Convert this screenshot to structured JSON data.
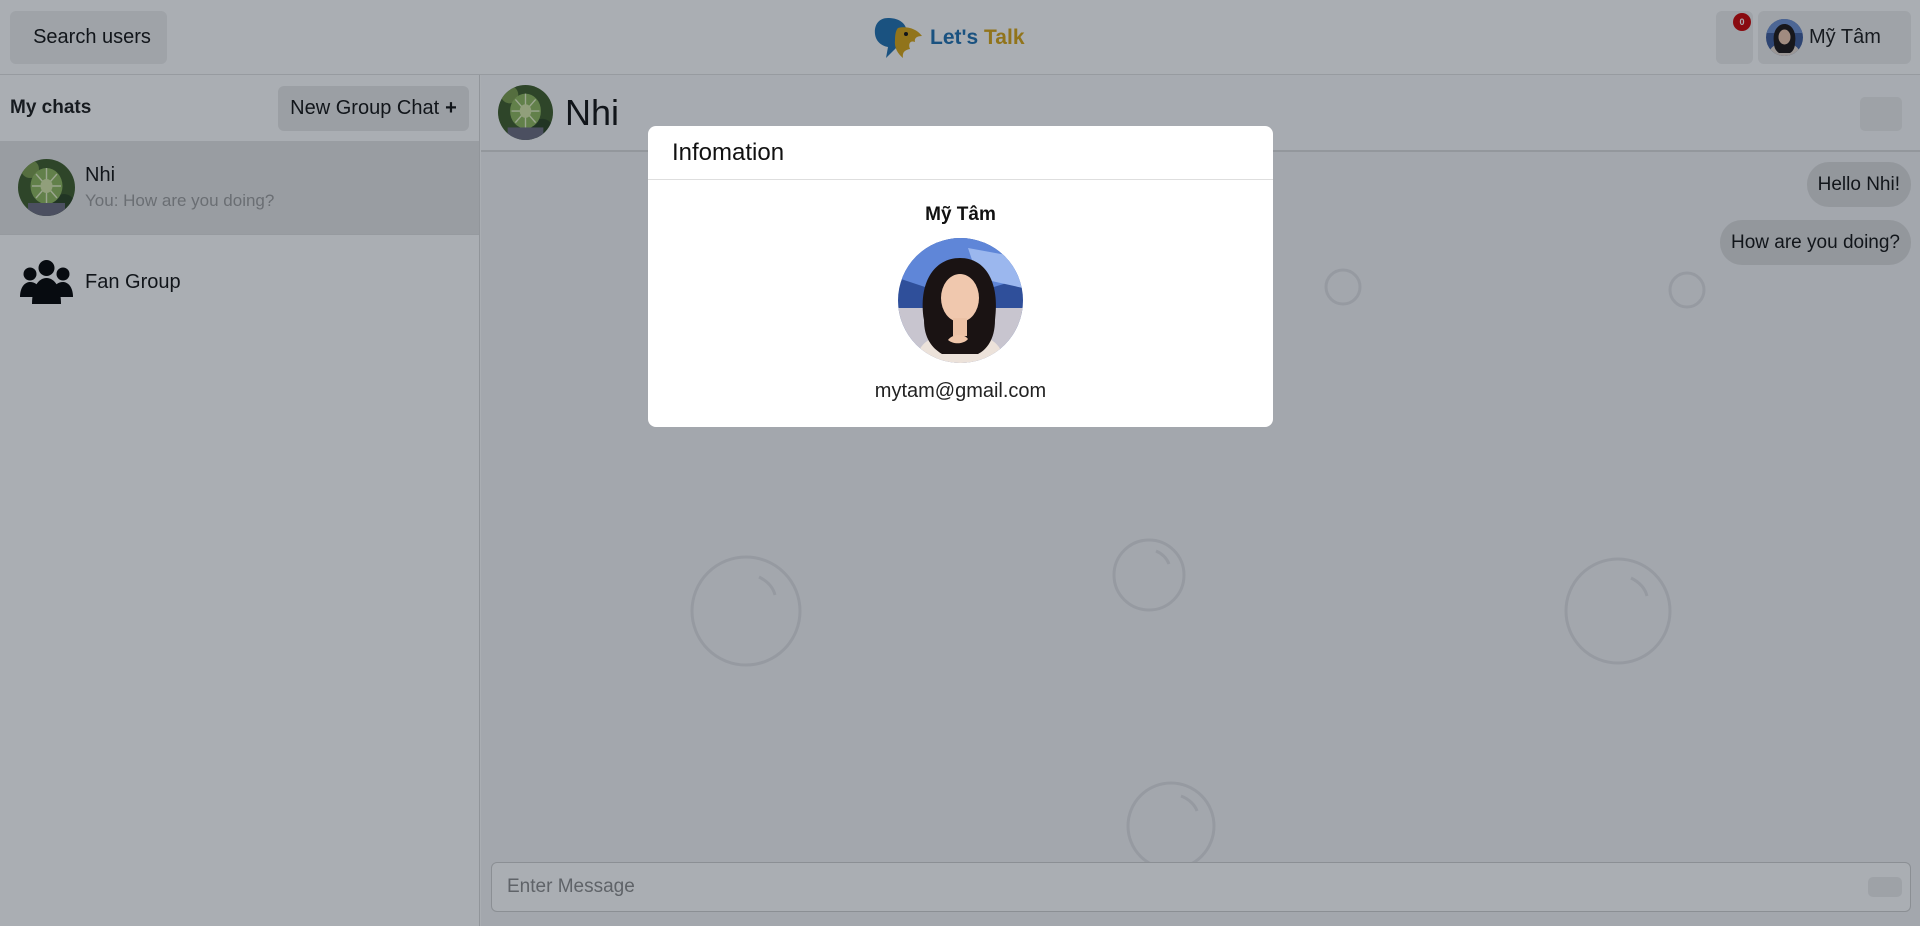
{
  "app": {
    "name_part1": "Let's",
    "name_part2": "Talk",
    "logo_icon": "parrot-logo-icon",
    "brand_colors": {
      "blue": "#1e6fb0",
      "gold": "#d8a512"
    }
  },
  "header": {
    "search_icon": "search-icon",
    "search_glyph": "",
    "search_label": "Search users",
    "bell_icon": "bell-icon",
    "bell_glyph": "",
    "notification_count": "0",
    "badge_color": "#cc0000",
    "user_name": "Mỹ Tâm",
    "user_chevron_icon": "chevron-down-icon",
    "user_chevron_glyph": ""
  },
  "sidebar": {
    "title": "My chats",
    "new_group_label": "New Group Chat",
    "new_group_plus": "+",
    "chats": [
      {
        "name": "Nhi",
        "last_message": "You: How are you doing?",
        "avatar": "cactus-avatar",
        "selected": true
      },
      {
        "name": "Fan Group",
        "last_message": "",
        "avatar": "group-icon",
        "selected": false
      }
    ]
  },
  "chat": {
    "title": "Nhi",
    "info_icon": "eye-icon",
    "info_glyph": "",
    "messages": [
      {
        "text": "Hello Nhi!",
        "from": "me"
      },
      {
        "text": "How are you doing?",
        "from": "me"
      }
    ],
    "input_placeholder": "Enter Message",
    "send_icon": "send-icon",
    "send_glyph": ""
  },
  "modal": {
    "title": "Infomation",
    "close_icon": "close-icon",
    "close_glyph": "",
    "user_name": "Mỹ Tâm",
    "email": "mytam@gmail.com"
  }
}
